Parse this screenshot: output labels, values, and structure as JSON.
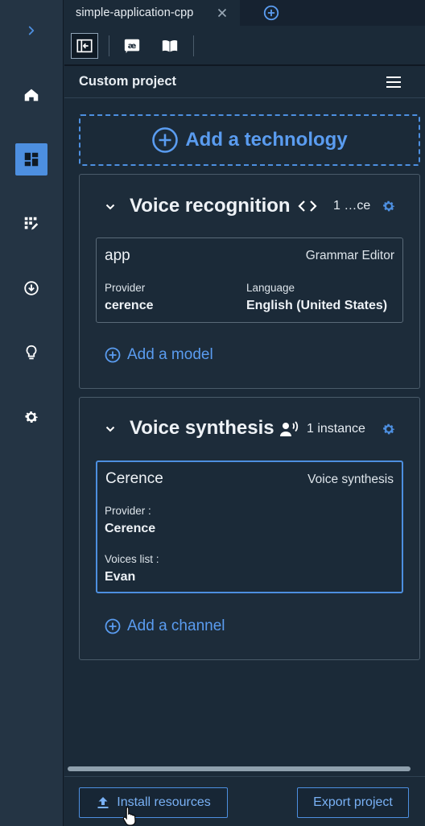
{
  "tabs": [
    {
      "label": "simple-application-cpp"
    }
  ],
  "panel": {
    "title": "Custom project"
  },
  "add_technology_label": "Add a technology",
  "technologies": [
    {
      "title": "Voice recognition",
      "icon": "code-icon",
      "count_label": "1 …ce",
      "items": [
        {
          "name": "app",
          "type": "Grammar Editor",
          "provider_label": "Provider",
          "provider_value": "cerence",
          "language_label": "Language",
          "language_value": "English (United States)"
        }
      ],
      "add_label": "Add a model"
    },
    {
      "title": "Voice synthesis",
      "icon": "speaker-person-icon",
      "count_label": "1 instance",
      "items": [
        {
          "name": "Cerence",
          "type": "Voice synthesis",
          "provider_label": "Provider :",
          "provider_value": "Cerence",
          "voices_label": "Voices list :",
          "voices_value": "Evan"
        }
      ],
      "add_label": "Add a channel"
    }
  ],
  "footer": {
    "install_label": "Install resources",
    "export_label": "Export project"
  },
  "colors": {
    "accent": "#4d8fe0",
    "link": "#5a9cf0",
    "background": "#1b2a38",
    "rail": "#243444"
  }
}
